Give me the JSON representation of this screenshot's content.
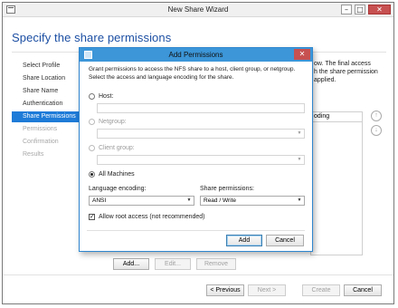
{
  "wizard": {
    "title": "New Share Wizard",
    "window_controls": {
      "minimize": "–",
      "maximize": "□",
      "close": "✕"
    },
    "heading": "Specify the share permissions",
    "nav": [
      {
        "label": "Select Profile",
        "state": "normal"
      },
      {
        "label": "Share Location",
        "state": "normal"
      },
      {
        "label": "Share Name",
        "state": "normal"
      },
      {
        "label": "Authentication",
        "state": "normal"
      },
      {
        "label": "Share Permissions",
        "state": "active"
      },
      {
        "label": "Permissions",
        "state": "disabled"
      },
      {
        "label": "Confirmation",
        "state": "disabled"
      },
      {
        "label": "Results",
        "state": "disabled"
      }
    ],
    "desc_lines": [
      "ow. The final access",
      "h the share permission",
      "applied."
    ],
    "table_header_fragment": "oding",
    "up_icon": "up-arrow-icon",
    "down_icon": "down-arrow-icon",
    "up_glyph": "↑",
    "down_glyph": "↓",
    "list_buttons": {
      "add": "Add...",
      "edit": "Edit...",
      "remove": "Remove"
    },
    "footer_buttons": {
      "previous": "< Previous",
      "next": "Next >",
      "create": "Create",
      "cancel": "Cancel"
    }
  },
  "dialog": {
    "title": "Add Permissions",
    "close_glyph": "✕",
    "intro_line1": "Grant permissions to access the NFS share to a host, client group, or netgroup.",
    "intro_line2": "Select the access and language encoding for the share.",
    "options": {
      "host": {
        "label": "Host:",
        "selected": false,
        "enabled": true
      },
      "netgroup": {
        "label": "Netgroup:",
        "selected": false,
        "enabled": false
      },
      "client_group": {
        "label": "Client group:",
        "selected": false,
        "enabled": false
      },
      "all_machines": {
        "label": "All Machines",
        "selected": true,
        "enabled": true
      }
    },
    "language_encoding": {
      "label": "Language encoding:",
      "value": "ANSI"
    },
    "share_permissions": {
      "label": "Share permissions:",
      "value": "Read / Write"
    },
    "root_access": {
      "label": "Allow root access (not recommended)",
      "checked": true,
      "check_glyph": "✓"
    },
    "buttons": {
      "add": "Add",
      "cancel": "Cancel"
    },
    "combo_arrow": "▼"
  },
  "colors": {
    "heading_blue": "#1c4fa3",
    "nav_active": "#1e7bd8",
    "dialog_titlebar": "#3c96d8",
    "close_red": "#c75050"
  }
}
